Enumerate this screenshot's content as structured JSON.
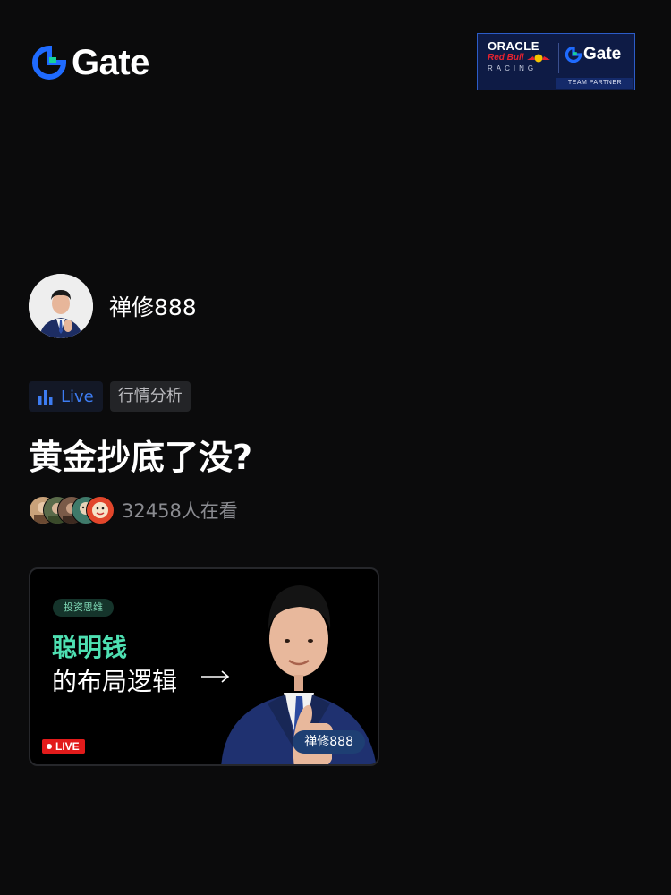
{
  "brand": {
    "name": "Gate",
    "accent": "#1f6bff",
    "accent_green": "#16d19a"
  },
  "partner": {
    "oracle": "ORACLE",
    "redbull": "Red Bull",
    "racing": "RACING",
    "gate": "Gate",
    "team": "TEAM PARTNER",
    "bg": "#0e1b45"
  },
  "host": {
    "name": "禅修888",
    "avatar_icon": "host-avatar"
  },
  "tags": {
    "live_label": "Live",
    "live_color": "#3d7cf2",
    "category": "行情分析"
  },
  "stream": {
    "title": "黄金抄底了没?"
  },
  "viewers": {
    "text": "32458人在看",
    "count": 32458
  },
  "card": {
    "tag": "投资思维",
    "headline_1": "聪明钱",
    "headline_2": "的布局逻辑",
    "host_label": "禅修888",
    "live_label": "LIVE",
    "headline_color": "#4ee0b2"
  }
}
